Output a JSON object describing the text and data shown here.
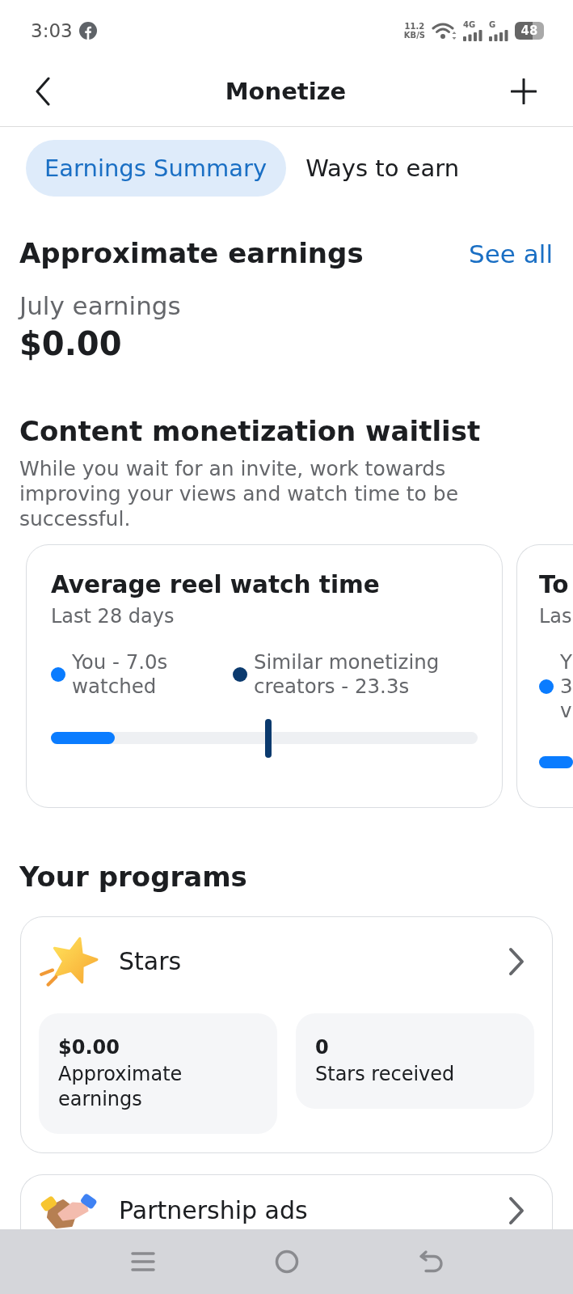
{
  "status_bar": {
    "time": "3:03",
    "network_speed": "11.2",
    "network_speed_unit": "KB/S",
    "signals": [
      {
        "label": "4G"
      },
      {
        "label": "G"
      }
    ],
    "battery": "48"
  },
  "header": {
    "title": "Monetize"
  },
  "tabs": [
    {
      "label": "Earnings Summary",
      "selected": true
    },
    {
      "label": "Ways to earn",
      "selected": false
    }
  ],
  "earnings": {
    "title": "Approximate earnings",
    "link": "See all",
    "period_label": "July earnings",
    "amount": "$0.00"
  },
  "waitlist": {
    "title": "Content monetization waitlist",
    "description": "While you wait for an invite, work towards improving your views and watch time to be successful.",
    "cards": [
      {
        "title": "Average reel watch time",
        "subtitle": "Last 28 days",
        "legend": [
          {
            "text": "You - 7.0s watched",
            "color": "#0a7cff"
          },
          {
            "text": "Similar monetizing creators - 23.3s",
            "color": "#0b3a6e"
          }
        ],
        "level": 0.15,
        "benchmark": {
          "level": 0.51
        }
      },
      {
        "title": "To",
        "subtitle": "Las",
        "legend": [
          {
            "text": "Y 3 v",
            "color": "#0a7cff"
          }
        ],
        "level": 1
      }
    ]
  },
  "programs": {
    "title": "Your programs",
    "items": [
      {
        "kind": "star",
        "name": "Stars",
        "stats": [
          {
            "value": "$0.00",
            "label": "Approximate earnings"
          },
          {
            "value": "0",
            "label": "Stars received"
          }
        ]
      },
      {
        "kind": "handshake",
        "name": "Partnership ads"
      }
    ]
  }
}
